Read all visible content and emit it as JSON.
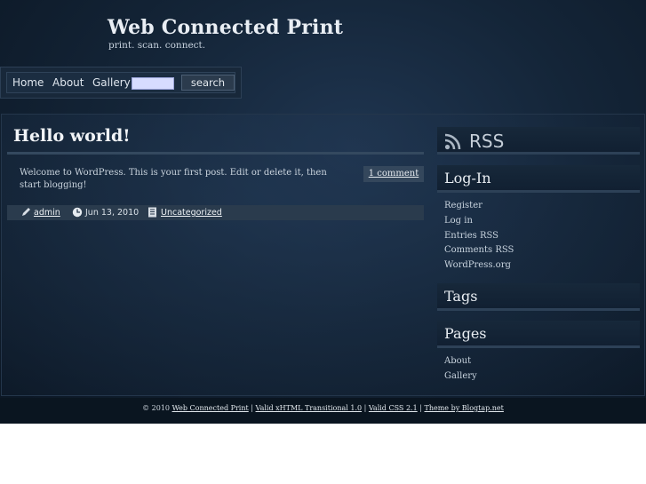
{
  "site": {
    "title": "Web Connected Print",
    "tagline": "print. scan. connect."
  },
  "nav": {
    "items": [
      "Home",
      "About",
      "Gallery"
    ],
    "search_value": "",
    "search_button": "search"
  },
  "post": {
    "title": "Hello world!",
    "body": "Welcome to WordPress. This is your first post. Edit or delete it, then start blogging!",
    "comments": "1 comment",
    "author": "admin",
    "date": "Jun 13, 2010",
    "category": "Uncategorized"
  },
  "sidebar": {
    "rss_title": "RSS",
    "login_title": "Log-In",
    "login_links": [
      "Register",
      "Log in",
      "Entries RSS",
      "Comments RSS",
      "WordPress.org"
    ],
    "tags_title": "Tags",
    "pages_title": "Pages",
    "pages_links": [
      "About",
      "Gallery"
    ]
  },
  "footer": {
    "copyright": "© 2010",
    "site_link": "Web Connected Print",
    "sep": "|",
    "xhtml": "Valid xHTML Transitional 1.0",
    "css": "Valid CSS 2.1",
    "theme": "Theme by Blogtap.net"
  },
  "colors": {
    "background": "#142538",
    "header_text": "#e9eef4",
    "meta_bar": "#2a3b4d",
    "search_field": "#d7dcff"
  },
  "icons": [
    "pencil-icon",
    "clock-icon",
    "document-icon",
    "rss-feed-icon"
  ]
}
